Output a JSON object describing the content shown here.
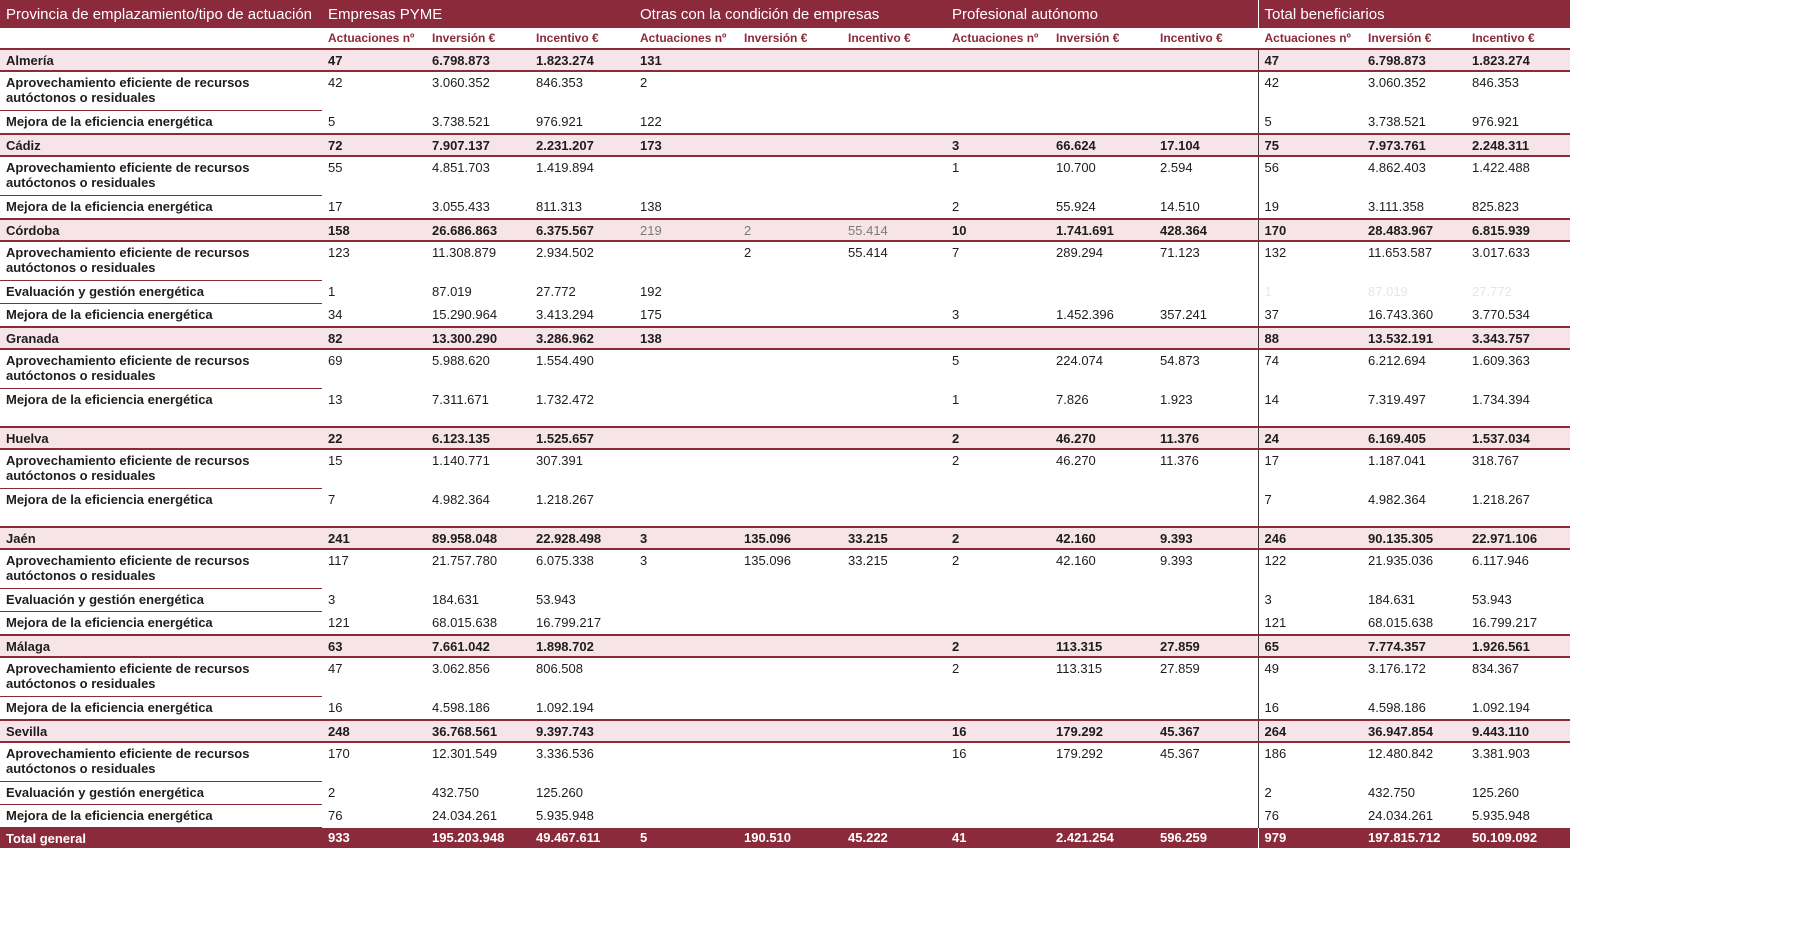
{
  "header": {
    "col0": "Provincia de emplazamiento/tipo de actuación",
    "groups": [
      "Empresas PYME",
      "Otras con la condición de empresas",
      "Profesional autónomo",
      "Total beneficiarios"
    ],
    "sub": [
      "Actuaciones nº",
      "Inversión €",
      "Incentivo €"
    ]
  },
  "rows": [
    {
      "t": "p",
      "h": 1,
      "label": "Almería",
      "c": [
        "47",
        "6.798.873",
        "1.823.274",
        "131",
        "",
        "",
        "",
        "",
        "",
        "47",
        "6.798.873",
        "1.823.274"
      ]
    },
    {
      "t": "s",
      "h": 2,
      "label": "Aprovechamiento eficiente de recursos autóctonos o residuales",
      "c": [
        "42",
        "3.060.352",
        "846.353",
        "2",
        "",
        "",
        "",
        "",
        "",
        "42",
        "3.060.352",
        "846.353"
      ]
    },
    {
      "t": "s",
      "h": 1,
      "label": "Mejora de la eficiencia energética",
      "c": [
        "5",
        "3.738.521",
        "976.921",
        "122",
        "",
        "",
        "",
        "",
        "",
        "5",
        "3.738.521",
        "976.921"
      ]
    },
    {
      "t": "p",
      "h": 1,
      "label": "Cádiz",
      "c": [
        "72",
        "7.907.137",
        "2.231.207",
        "173",
        "",
        "",
        "3",
        "66.624",
        "17.104",
        "75",
        "7.973.761",
        "2.248.311"
      ]
    },
    {
      "t": "s",
      "h": 2,
      "label": "Aprovechamiento eficiente de recursos autóctonos o residuales",
      "c": [
        "55",
        "4.851.703",
        "1.419.894",
        "",
        "",
        "",
        "1",
        "10.700",
        "2.594",
        "56",
        "4.862.403",
        "1.422.488"
      ]
    },
    {
      "t": "s",
      "h": 1,
      "label": "Mejora de la eficiencia energética",
      "c": [
        "17",
        "3.055.433",
        "811.313",
        "138",
        "",
        "",
        "2",
        "55.924",
        "14.510",
        "19",
        "3.111.358",
        "825.823"
      ]
    },
    {
      "t": "p",
      "h": 1,
      "label": "Córdoba",
      "c": [
        "158",
        "26.686.863",
        "6.375.567",
        "219",
        "2",
        "55.414",
        "10",
        "1.741.691",
        "428.364",
        "170",
        "28.483.967",
        "6.815.939"
      ],
      "faint": [
        3,
        4,
        5
      ]
    },
    {
      "t": "s",
      "h": 2,
      "label": "Aprovechamiento eficiente de recursos autóctonos o residuales",
      "c": [
        "123",
        "11.308.879",
        "2.934.502",
        "",
        "2",
        "55.414",
        "7",
        "289.294",
        "71.123",
        "132",
        "11.653.587",
        "3.017.633"
      ]
    },
    {
      "t": "s",
      "h": 1,
      "label": "Evaluación y gestión energética",
      "c": [
        "1",
        "87.019",
        "27.772",
        "192",
        "",
        "",
        "",
        "",
        "",
        "1",
        "87.019",
        "27.772"
      ],
      "ghost": [
        9,
        10,
        11
      ]
    },
    {
      "t": "s",
      "h": 1,
      "label": "Mejora de la eficiencia energética",
      "c": [
        "34",
        "15.290.964",
        "3.413.294",
        "175",
        "",
        "",
        "3",
        "1.452.396",
        "357.241",
        "37",
        "16.743.360",
        "3.770.534"
      ]
    },
    {
      "t": "p",
      "h": 1,
      "label": "Granada",
      "c": [
        "82",
        "13.300.290",
        "3.286.962",
        "138",
        "",
        "",
        "",
        "",
        "",
        "88",
        "13.532.191",
        "3.343.757"
      ]
    },
    {
      "t": "s",
      "h": 2,
      "label": "Aprovechamiento eficiente de recursos autóctonos o residuales",
      "c": [
        "69",
        "5.988.620",
        "1.554.490",
        "",
        "",
        "",
        "5",
        "224.074",
        "54.873",
        "74",
        "6.212.694",
        "1.609.363"
      ]
    },
    {
      "t": "s",
      "h": 3,
      "label": "Mejora de la eficiencia energética",
      "c": [
        "13",
        "7.311.671",
        "1.732.472",
        "",
        "",
        "",
        "1",
        "7.826",
        "1.923",
        "14",
        "7.319.497",
        "1.734.394"
      ]
    },
    {
      "t": "p",
      "h": 1,
      "label": "Huelva",
      "c": [
        "22",
        "6.123.135",
        "1.525.657",
        "",
        "",
        "",
        "2",
        "46.270",
        "11.376",
        "24",
        "6.169.405",
        "1.537.034"
      ]
    },
    {
      "t": "s",
      "h": 2,
      "label": "Aprovechamiento eficiente de recursos autóctonos o residuales",
      "c": [
        "15",
        "1.140.771",
        "307.391",
        "",
        "",
        "",
        "2",
        "46.270",
        "11.376",
        "17",
        "1.187.041",
        "318.767"
      ]
    },
    {
      "t": "s",
      "h": 3,
      "label": "Mejora de la eficiencia energética",
      "c": [
        "7",
        "4.982.364",
        "1.218.267",
        "",
        "",
        "",
        "",
        "",
        "",
        "7",
        "4.982.364",
        "1.218.267"
      ]
    },
    {
      "t": "p",
      "h": 1,
      "label": "Jaén",
      "c": [
        "241",
        "89.958.048",
        "22.928.498",
        "3",
        "135.096",
        "33.215",
        "2",
        "42.160",
        "9.393",
        "246",
        "90.135.305",
        "22.971.106"
      ]
    },
    {
      "t": "s",
      "h": 2,
      "label": "Aprovechamiento eficiente de recursos autóctonos o residuales",
      "c": [
        "117",
        "21.757.780",
        "6.075.338",
        "3",
        "135.096",
        "33.215",
        "2",
        "42.160",
        "9.393",
        "122",
        "21.935.036",
        "6.117.946"
      ]
    },
    {
      "t": "s",
      "h": 1,
      "label": "Evaluación y gestión energética",
      "c": [
        "3",
        "184.631",
        "53.943",
        "",
        "",
        "",
        "",
        "",
        "",
        "3",
        "184.631",
        "53.943"
      ]
    },
    {
      "t": "s",
      "h": 1,
      "label": "Mejora de la eficiencia energética",
      "c": [
        "121",
        "68.015.638",
        "16.799.217",
        "",
        "",
        "",
        "",
        "",
        "",
        "121",
        "68.015.638",
        "16.799.217"
      ]
    },
    {
      "t": "p",
      "h": 1,
      "label": "Málaga",
      "c": [
        "63",
        "7.661.042",
        "1.898.702",
        "",
        "",
        "",
        "2",
        "113.315",
        "27.859",
        "65",
        "7.774.357",
        "1.926.561"
      ]
    },
    {
      "t": "s",
      "h": 2,
      "label": "Aprovechamiento eficiente de recursos autóctonos o residuales",
      "c": [
        "47",
        "3.062.856",
        "806.508",
        "",
        "",
        "",
        "2",
        "113.315",
        "27.859",
        "49",
        "3.176.172",
        "834.367"
      ]
    },
    {
      "t": "s",
      "h": 1,
      "label": "Mejora de la eficiencia energética",
      "c": [
        "16",
        "4.598.186",
        "1.092.194",
        "",
        "",
        "",
        "",
        "",
        "",
        "16",
        "4.598.186",
        "1.092.194"
      ]
    },
    {
      "t": "p",
      "h": 1,
      "label": "Sevilla",
      "c": [
        "248",
        "36.768.561",
        "9.397.743",
        "",
        "",
        "",
        "16",
        "179.292",
        "45.367",
        "264",
        "36.947.854",
        "9.443.110"
      ]
    },
    {
      "t": "s",
      "h": 2,
      "label": "Aprovechamiento eficiente de recursos autóctonos o residuales",
      "c": [
        "170",
        "12.301.549",
        "3.336.536",
        "",
        "",
        "",
        "16",
        "179.292",
        "45.367",
        "186",
        "12.480.842",
        "3.381.903"
      ]
    },
    {
      "t": "s",
      "h": 1,
      "label": "Evaluación y gestión energética",
      "c": [
        "2",
        "432.750",
        "125.260",
        "",
        "",
        "",
        "",
        "",
        "",
        "2",
        "432.750",
        "125.260"
      ]
    },
    {
      "t": "s",
      "h": 1,
      "label": "Mejora de la eficiencia energética",
      "c": [
        "76",
        "24.034.261",
        "5.935.948",
        "",
        "",
        "",
        "",
        "",
        "",
        "76",
        "24.034.261",
        "5.935.948"
      ]
    }
  ],
  "total": {
    "label": "Total general",
    "c": [
      "933",
      "195.203.948",
      "49.467.611",
      "5",
      "190.510",
      "45.222",
      "41",
      "2.421.254",
      "596.259",
      "979",
      "197.815.712",
      "50.109.092"
    ]
  },
  "colors": {
    "accent": "#8b2a3b",
    "province_bg": "#f7e4e8"
  }
}
